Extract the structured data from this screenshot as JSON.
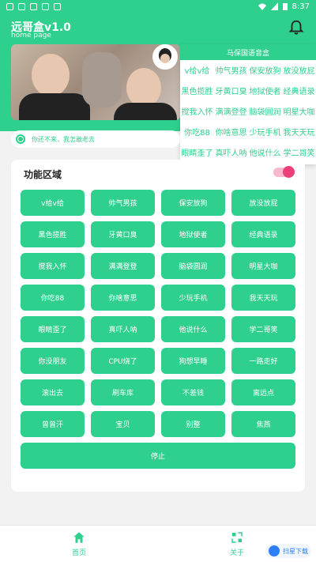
{
  "status_bar": {
    "time": "8:37"
  },
  "header": {
    "title": "远哥盒v1.0",
    "subtitle": "home page"
  },
  "dropdown": {
    "title": "马保国语音盒",
    "items": [
      "v给v给",
      "帅气男孩",
      "保安放狗",
      "放没放屁",
      "黑色揽胜",
      "牙黄口臭",
      "地狱使者",
      "经典语录",
      "搅我入怀",
      "满满登登",
      "脑袋圆润",
      "明星大咖",
      "你吃88",
      "你啥意思",
      "少玩手机",
      "我天天玩",
      "眼睛歪了",
      "真吓人呐",
      "他说什么",
      "学二哥笑"
    ]
  },
  "notice": {
    "text": "你还不来，我怎敢老去"
  },
  "panel": {
    "title": "功能区域",
    "buttons": [
      "v给v给",
      "帅气男孩",
      "保安放狗",
      "放没放屁",
      "黑色揽胜",
      "牙黄口臭",
      "地狱使者",
      "经典语录",
      "搅我入怀",
      "满满登登",
      "脑袋圆润",
      "明星大咖",
      "你吃88",
      "你啥意思",
      "少玩手机",
      "我天天玩",
      "眼睛歪了",
      "真吓人呐",
      "他说什么",
      "学二哥笑",
      "你没朋友",
      "CPU烧了",
      "狗想早睡",
      "一路走好",
      "滚出去",
      "刷车库",
      "不差钱",
      "离远点",
      "曾曾汗",
      "宝贝",
      "别整",
      "焦燕"
    ],
    "stop_label": "停止"
  },
  "bottom_nav": {
    "home_label": "首页",
    "about_label": "关于"
  },
  "watermark": {
    "text": "扫星下载"
  },
  "colors": {
    "accent": "#2fd08e",
    "toggle": "#ef3f7a"
  }
}
